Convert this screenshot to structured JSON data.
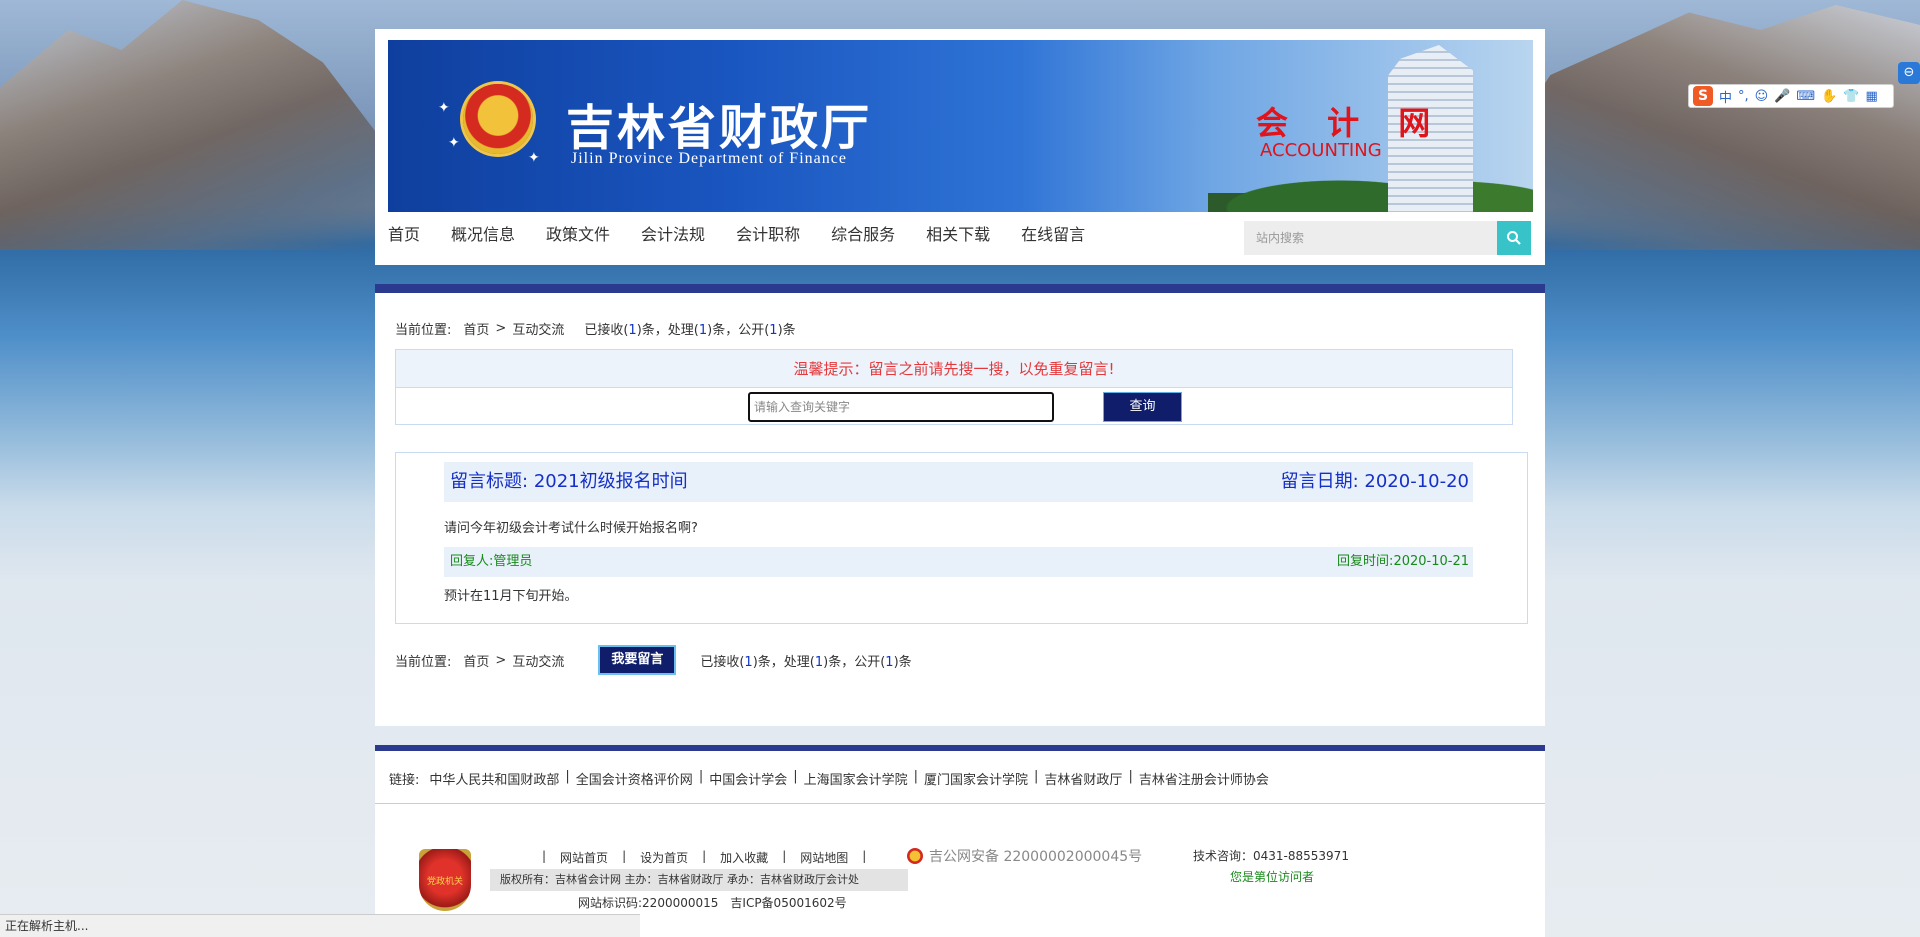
{
  "header": {
    "site_title_cn": "吉林省财政厅",
    "site_title_en": "Jilin Province Department of Finance",
    "section_cn": "会 计 网",
    "section_en": "ACCOUNTING"
  },
  "nav": {
    "items": [
      "首页",
      "概况信息",
      "政策文件",
      "会计法规",
      "会计职称",
      "综合服务",
      "相关下载",
      "在线留言"
    ]
  },
  "search": {
    "placeholder": "站内搜索"
  },
  "breadcrumb": {
    "label": "当前位置:",
    "home": "首页",
    "separator": ">",
    "current": "互动交流",
    "stats_prefix": "已接收(",
    "received": "1",
    "stats_mid1": ")条，处理(",
    "processed": "1",
    "stats_mid2": ")条，公开(",
    "published": "1",
    "stats_suffix": ")条"
  },
  "notice": {
    "tip": "温馨提示：留言之前请先搜一搜，以免重复留言!",
    "query_placeholder": "请输入查询关键字",
    "query_button": "查询"
  },
  "message": {
    "title_label": "留言标题:",
    "title": "2021初级报名时间",
    "date_label": "留言日期:",
    "date": "2020-10-20",
    "content": "请问今年初级会计考试什么时候开始报名啊?",
    "replier_label": "回复人:",
    "replier": "管理员",
    "reply_time_label": "回复时间:",
    "reply_time": "2020-10-21",
    "reply_content": "预计在11月下旬开始。"
  },
  "actions": {
    "leave_message": "我要留言"
  },
  "footer": {
    "links_label": "链接:",
    "links": [
      "中华人民共和国财政部",
      "全国会计资格评价网",
      "中国会计学会",
      "上海国家会计学院",
      "厦门国家会计学院",
      "吉林省财政厅",
      "吉林省注册会计师协会"
    ],
    "foot_nav": [
      "|",
      "网站首页",
      "|",
      "设为首页",
      "|",
      "加入收藏",
      "|",
      "网站地图",
      "|"
    ],
    "copyright": "版权所有：吉林省会计网 主办：吉林省财政厅 承办：吉林省财政厅会计处",
    "site_code": "网站标识码:2200000015",
    "icp": "吉ICP备05001602号",
    "police": "吉公网安备 22000002000045号",
    "tech": "技术咨询：0431-88553971",
    "visitor": "您是第位访问者",
    "party_logo_text": "党政机关"
  },
  "ime": {
    "logo": "S",
    "items": [
      "中",
      "°,",
      "☺",
      "🎤",
      "⌨",
      "✋",
      "👕",
      "▦"
    ]
  },
  "side_icon": "⊖",
  "status_bar": "正在解析主机..."
}
